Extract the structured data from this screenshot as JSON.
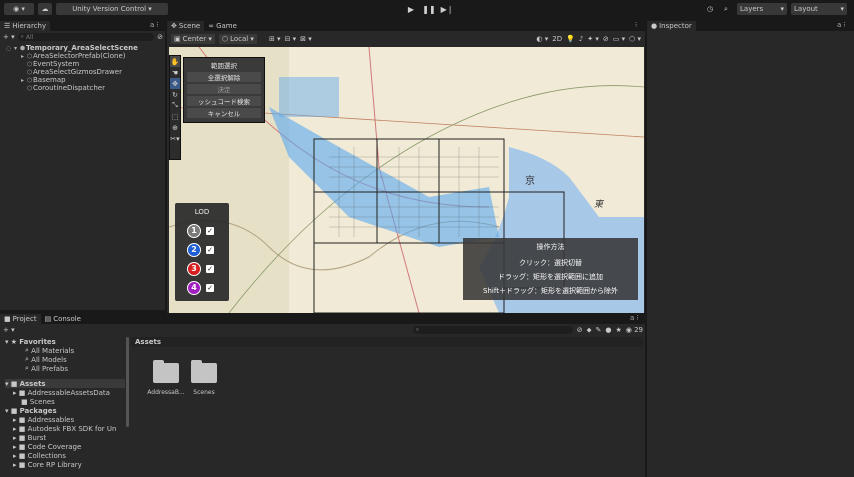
{
  "toolbar": {
    "account_icon": "person-circle-icon",
    "cloud_icon": "cloud-icon",
    "vcs_label": "Unity Version Control ▾",
    "play_icon": "play-icon",
    "pause_icon": "pause-icon",
    "step_icon": "step-icon",
    "history_icon": "history-icon",
    "search_icon": "search-icon",
    "layers_label": "Layers",
    "layout_label": "Layout"
  },
  "hierarchy": {
    "tab": "Hierarchy",
    "search_placeholder": "All",
    "items": [
      {
        "label": "Temporary_AreaSelectScene",
        "indent": 0,
        "bold": true
      },
      {
        "label": "AreaSelectorPrefab(Clone)",
        "indent": 1
      },
      {
        "label": "EventSystem",
        "indent": 1
      },
      {
        "label": "AreaSelectGizmosDrawer",
        "indent": 1
      },
      {
        "label": "Basemap",
        "indent": 1
      },
      {
        "label": "CoroutineDispatcher",
        "indent": 1
      }
    ]
  },
  "scene": {
    "tab_scene": "Scene",
    "tab_game": "Game",
    "pivot": "Center ▾",
    "space": "Local ▾",
    "mode_2d": "2D"
  },
  "area_menu": {
    "items": [
      "範囲選択",
      "全選択解除",
      "決定",
      "ッシュコード検索",
      "キャンセル"
    ]
  },
  "lod": {
    "title": "LOD",
    "levels": [
      {
        "n": "1",
        "color": "#7a7a7a",
        "checked": "✓"
      },
      {
        "n": "2",
        "color": "#1e5fd6",
        "checked": "✓"
      },
      {
        "n": "3",
        "color": "#d71f1f",
        "checked": "✓"
      },
      {
        "n": "4",
        "color": "#a01ec2",
        "checked": "✓"
      }
    ]
  },
  "map": {
    "label_kyo": "京",
    "label_higashi": "東"
  },
  "help": {
    "title": "操作方法",
    "lines": [
      "クリック：選択切替",
      "ドラッグ：矩形を選択範囲に追加",
      "Shift＋ドラッグ：矩形を選択範囲から除外"
    ]
  },
  "inspector": {
    "tab": "Inspector"
  },
  "project": {
    "tab_project": "Project",
    "tab_console": "Console",
    "assets_header": "Assets",
    "count": "29",
    "favorites": "Favorites",
    "fav_items": [
      "All Materials",
      "All Models",
      "All Prefabs"
    ],
    "assets": "Assets",
    "asset_items": [
      "AddressableAssetsData",
      "Scenes"
    ],
    "packages": "Packages",
    "package_items": [
      "Addressables",
      "Autodesk FBX SDK for Un",
      "Burst",
      "Code Coverage",
      "Collections",
      "Core RP Library"
    ],
    "grid": [
      "AddressaB...",
      "Scenes"
    ]
  }
}
